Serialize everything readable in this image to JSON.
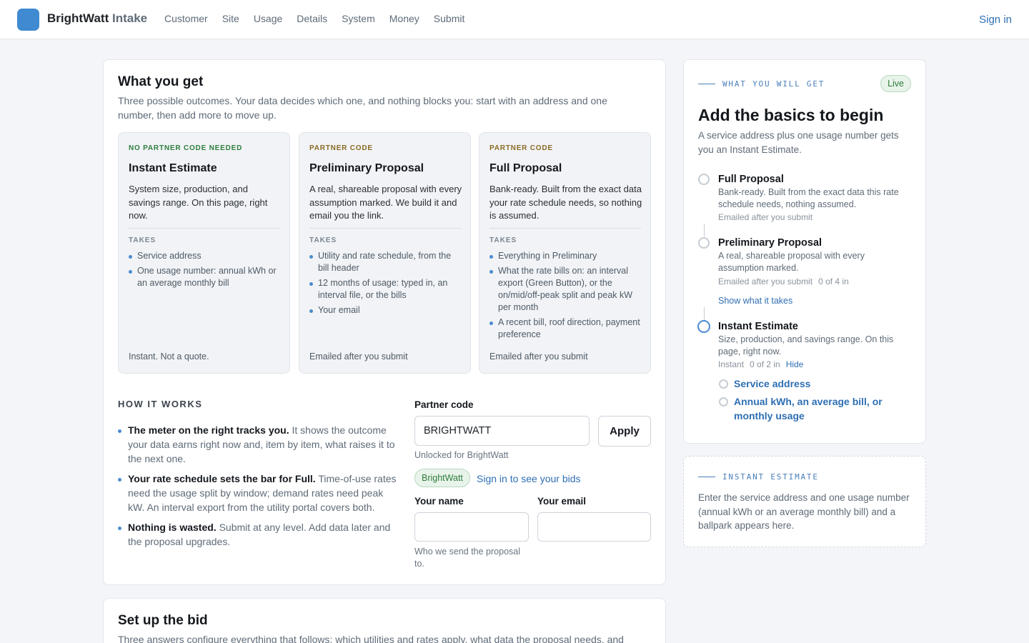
{
  "topbar": {
    "brand_main": "BrightWatt",
    "brand_sub": "Intake",
    "nav": [
      "Customer",
      "Site",
      "Usage",
      "Details",
      "System",
      "Money",
      "Submit"
    ],
    "signin": "Sign in"
  },
  "colors": {
    "accent": "#3f8ad1",
    "link": "#2f6fb3",
    "success": "#2f7d3e",
    "amber": "#8a6a23",
    "background": "#f3f5f8"
  },
  "main": {
    "title": "What you get",
    "lead": "Three possible outcomes. Your data decides which one, and nothing blocks you: start with an address and one number, then add more to move up.",
    "tiers": [
      {
        "kicker": "NO PARTNER CODE NEEDED",
        "title": "Instant Estimate",
        "desc": "System size, production, and savings range. On this page, right now.",
        "takes_label": "TAKES",
        "items": [
          "Service address",
          "One usage number: annual kWh or an average monthly bill"
        ],
        "foot": "Instant. Not a quote."
      },
      {
        "kicker": "PARTNER CODE",
        "title": "Preliminary Proposal",
        "desc": "A real, shareable proposal with every assumption marked. We build it and email you the link.",
        "takes_label": "TAKES",
        "items": [
          "Utility and rate schedule, from the bill header",
          "12 months of usage: typed in, an interval file, or the bills",
          "Your email"
        ],
        "foot": "Emailed after you submit"
      },
      {
        "kicker": "PARTNER CODE",
        "title": "Full Proposal",
        "desc": "Bank-ready. Built from the exact data your rate schedule needs, so nothing is assumed.",
        "takes_label": "TAKES",
        "items": [
          "Everything in Preliminary",
          "What the rate bills on: an interval export (Green Button), or the on/mid/off-peak split and peak kW per month",
          "A recent bill, roof direction, payment preference"
        ],
        "foot": "Emailed after you submit"
      }
    ],
    "how": {
      "heading": "HOW IT WORKS",
      "items": [
        {
          "bold": "The meter on the right tracks you.",
          "text": " It shows the outcome your data earns right now and, item by item, what raises it to the next one."
        },
        {
          "bold": "Your rate schedule sets the bar for Full.",
          "text": " Time-of-use rates need the usage split by window; demand rates need peak kW. An interval export from the utility portal covers both."
        },
        {
          "bold": "Nothing is wasted.",
          "text": " Submit at any level. Add data later and the proposal upgrades."
        }
      ]
    },
    "form": {
      "partner_label": "Partner code",
      "partner_value": "BRIGHTWATT",
      "apply": "Apply",
      "unlocked": "Unlocked for BrightWatt",
      "pill": "BrightWatt",
      "signin_bids": "Sign in to see your bids",
      "name_label": "Your name",
      "name_value": "",
      "email_label": "Your email",
      "email_value": "",
      "name_hint": "Who we send the proposal to."
    }
  },
  "setup": {
    "title": "Set up the bid",
    "lead": "Three answers configure everything that follows: which utilities and rates apply, what data the proposal needs, and"
  },
  "side": {
    "eyebrow": "WHAT YOU WILL GET",
    "live": "Live",
    "title": "Add the basics to begin",
    "lead": "A service address plus one usage number gets you an Instant Estimate.",
    "steps": [
      {
        "title": "Full Proposal",
        "desc": "Bank-ready. Built from the exact data this rate schedule needs, nothing assumed.",
        "meta": "Emailed after you submit"
      },
      {
        "title": "Preliminary Proposal",
        "desc": "A real, shareable proposal with every assumption marked.",
        "meta": "Emailed after you submit",
        "count": "0 of 4 in",
        "link": "Show what it takes"
      },
      {
        "title": "Instant Estimate",
        "desc": "Size, production, and savings range. On this page, right now.",
        "meta": "Instant",
        "count": "0 of 2 in",
        "hide": "Hide"
      }
    ],
    "subitems": [
      "Service address",
      "Annual kWh, an average bill, or monthly usage"
    ]
  },
  "estimate": {
    "eyebrow": "INSTANT ESTIMATE",
    "body": "Enter the service address and one usage number (annual kWh or an average monthly bill) and a ballpark appears here."
  }
}
